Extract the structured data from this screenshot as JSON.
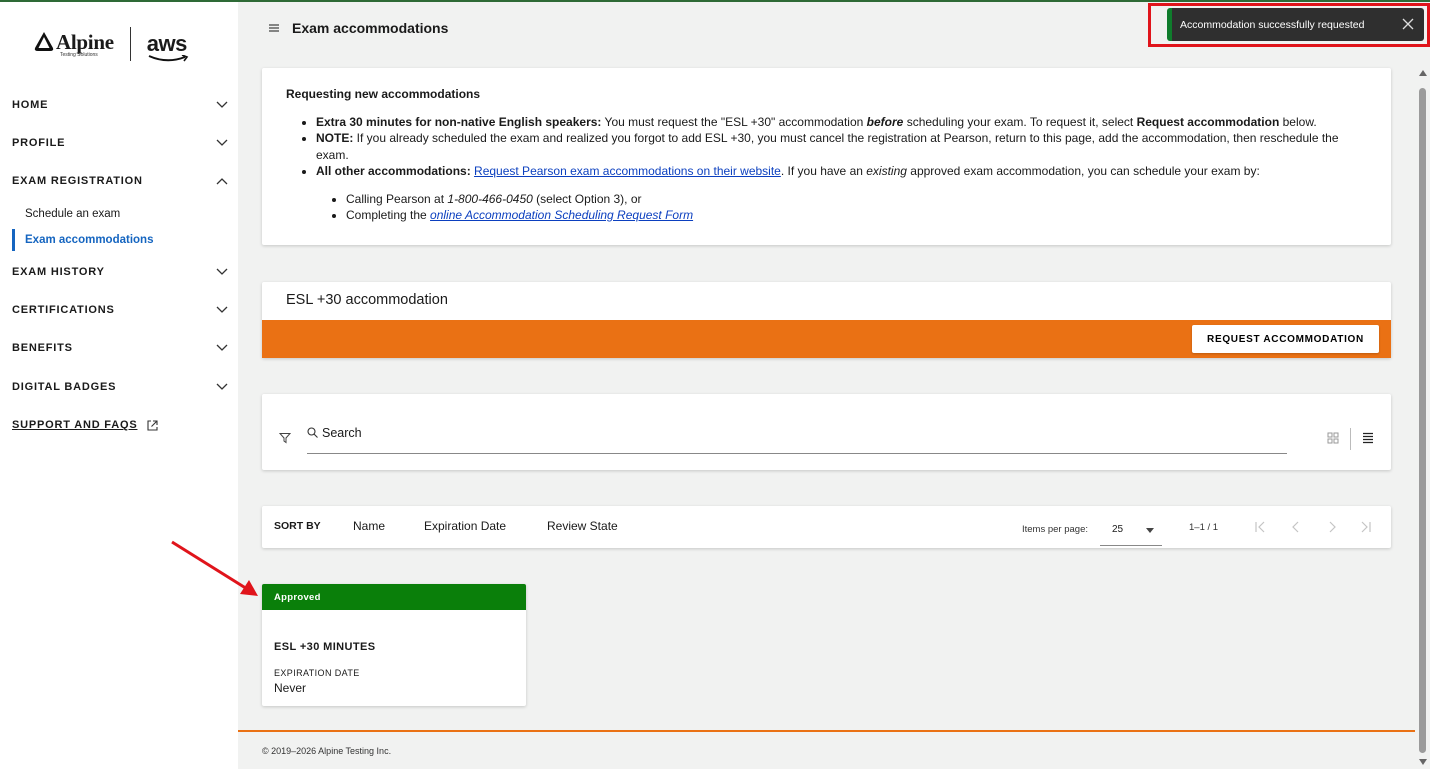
{
  "brand": {
    "logo_name": "Alpine",
    "logo_tagline": "Testing Solutions",
    "partner_logo": "aws"
  },
  "sidebar": {
    "items": [
      {
        "label": "HOME"
      },
      {
        "label": "PROFILE"
      },
      {
        "label": "EXAM REGISTRATION"
      },
      {
        "label": "EXAM HISTORY"
      },
      {
        "label": "CERTIFICATIONS"
      },
      {
        "label": "BENEFITS"
      },
      {
        "label": "DIGITAL BADGES"
      },
      {
        "label": "SUPPORT AND FAQS"
      }
    ],
    "subitems": [
      {
        "label": "Schedule an exam"
      },
      {
        "label": "Exam accommodations"
      }
    ]
  },
  "header": {
    "title": "Exam accommodations"
  },
  "toast": {
    "message": "Accommodation successfully requested"
  },
  "info": {
    "title": "Requesting new accommodations",
    "b1_bold": "Extra 30 minutes for non-native English speakers:",
    "b1_a": " You must request the \"ESL +30\" accommodation ",
    "b1_em": "before",
    "b1_b": " scheduling your exam. To request it, select ",
    "b1_bold2": "Request accommodation",
    "b1_c": " below.",
    "b2_bold": "NOTE:",
    "b2_text": " If you already scheduled the exam and realized you forgot to add ESL +30, you must cancel the registration at Pearson, return to this page, add the accommodation, then reschedule the exam.",
    "b3_bold": "All other accommodations:",
    "b3_space": " ",
    "b3_link": "Request Pearson exam accommodations on their website",
    "b3_a": ". If you have an ",
    "b3_em": "existing",
    "b3_b": " approved exam accommodation, you can schedule your exam by:",
    "s1_a": "Calling Pearson at ",
    "s1_em": "1-800-466-0450",
    "s1_b": " (select Option 3), or",
    "s2_a": "Completing the ",
    "s2_link": "online Accommodation Scheduling Request Form"
  },
  "esl": {
    "title": "ESL +30 accommodation",
    "button": "REQUEST ACCOMMODATION"
  },
  "search": {
    "placeholder": "Search"
  },
  "sort": {
    "label": "SORT BY",
    "options": [
      "Name",
      "Expiration Date",
      "Review State"
    ],
    "items_per_page_label": "Items per page:",
    "items_per_page": "25",
    "range": "1–1 / 1"
  },
  "result": {
    "status": "Approved",
    "status_color": "#0a7f0a",
    "name": "ESL +30 MINUTES",
    "expiration_label": "EXPIRATION DATE",
    "expiration_value": "Never"
  },
  "footer": {
    "copyright": "© 2019–2026 Alpine Testing Inc."
  },
  "colors": {
    "accent_orange": "#ea7114",
    "link_blue": "#0b3fbf",
    "active_nav": "#1565c0",
    "annotation_red": "#e0141b"
  }
}
